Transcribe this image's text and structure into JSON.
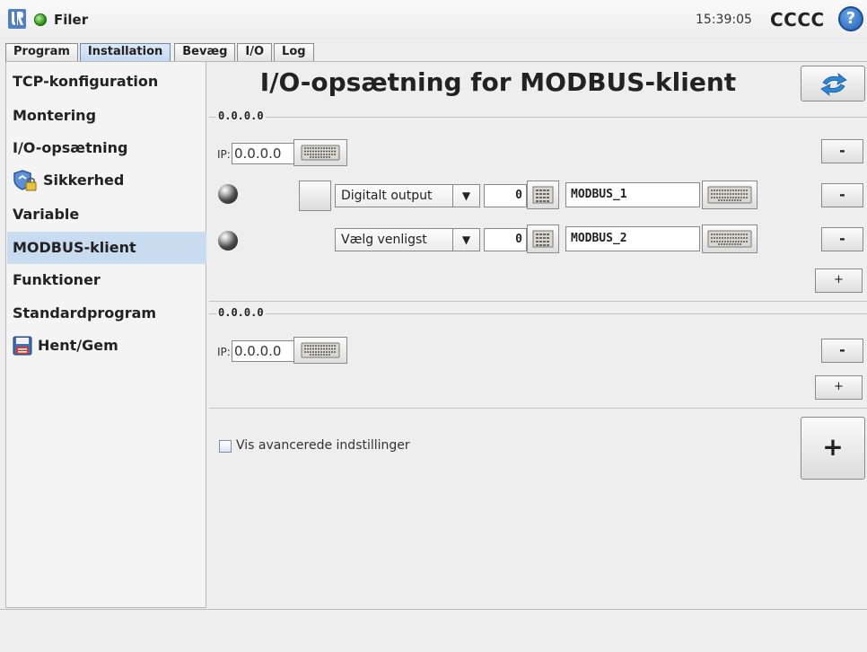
{
  "topbar": {
    "menu_title": "Filer",
    "clock": "15:39:05",
    "robot_name": "CCCC",
    "help_glyph": "?",
    "logo_icon": "ur-logo-icon",
    "status_color": "#2f9a1a"
  },
  "tabs": {
    "main": [
      {
        "label": "Program",
        "active": false
      },
      {
        "label": "Installation",
        "active": true
      }
    ],
    "sub": [
      {
        "label": "Bevæg"
      },
      {
        "label": "I/O"
      },
      {
        "label": "Log"
      }
    ]
  },
  "sidebar": {
    "items": [
      {
        "label": "TCP-konfiguration"
      },
      {
        "label": "Montering"
      },
      {
        "label": "I/O-opsætning"
      },
      {
        "label": "Sikkerhed",
        "icon": "shield-lock-icon"
      },
      {
        "label": "Variable"
      },
      {
        "label": "MODBUS-klient",
        "active": true
      },
      {
        "label": "Funktioner"
      },
      {
        "label": "Standardprogram"
      },
      {
        "label": "Hent/Gem",
        "icon": "floppy-disk-icon"
      }
    ],
    "active_color": "#c9dbef"
  },
  "main": {
    "title": "I/O-opsætning for MODBUS-klient",
    "groups": [
      {
        "legend": "0.0.0.0",
        "ip_label": "IP:",
        "ip_value": "0.0.0.0",
        "remove_label": "-",
        "add_label": "+",
        "signals": [
          {
            "type": "Digitalt output",
            "address": "0",
            "name": "MODBUS_1",
            "remove_label": "-"
          },
          {
            "type": "Vælg venligst",
            "address": "0",
            "name": "MODBUS_2",
            "remove_label": "-"
          }
        ]
      },
      {
        "legend": "0.0.0.0",
        "ip_label": "IP:",
        "ip_value": "0.0.0.0",
        "remove_label": "-",
        "add_label": "+",
        "signals": []
      }
    ],
    "advanced_checkbox_label": "Vis avancerede indstillinger",
    "advanced_checked": false,
    "add_device_label": "+"
  }
}
